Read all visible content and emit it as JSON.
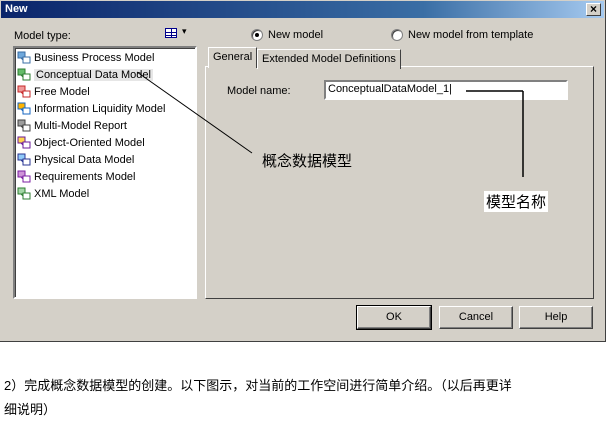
{
  "window": {
    "title": "New",
    "close_label": "×"
  },
  "left": {
    "model_type_label": "Model type:",
    "models": [
      {
        "label": "Business Process Model",
        "icon": "business-process-model-icon",
        "selected": false
      },
      {
        "label": "Conceptual Data Model",
        "icon": "conceptual-data-model-icon",
        "selected": true
      },
      {
        "label": "Free Model",
        "icon": "free-model-icon",
        "selected": false
      },
      {
        "label": "Information Liquidity Model",
        "icon": "information-liquidity-model-icon",
        "selected": false
      },
      {
        "label": "Multi-Model Report",
        "icon": "multi-model-report-icon",
        "selected": false
      },
      {
        "label": "Object-Oriented Model",
        "icon": "object-oriented-model-icon",
        "selected": false
      },
      {
        "label": "Physical Data Model",
        "icon": "physical-data-model-icon",
        "selected": false
      },
      {
        "label": "Requirements Model",
        "icon": "requirements-model-icon",
        "selected": false
      },
      {
        "label": "XML Model",
        "icon": "xml-model-icon",
        "selected": false
      }
    ]
  },
  "radios": {
    "new_model": {
      "label": "New model",
      "checked": true
    },
    "new_from_template": {
      "label": "New model from template",
      "checked": false
    }
  },
  "tabs": [
    {
      "label": "General",
      "active": true
    },
    {
      "label": "Extended Model Definitions",
      "active": false
    }
  ],
  "general": {
    "model_name_label": "Model name:",
    "model_name_value": "ConceptualDataModel_1"
  },
  "buttons": {
    "ok": "OK",
    "cancel": "Cancel",
    "help": "Help"
  },
  "annotations": {
    "concept_model": "概念数据模型",
    "model_name": "模型名称"
  },
  "caption": {
    "line1": "2）完成概念数据模型的创建。以下图示，对当前的工作空间进行简单介绍。（以后再更详",
    "line2": "细说明）"
  }
}
